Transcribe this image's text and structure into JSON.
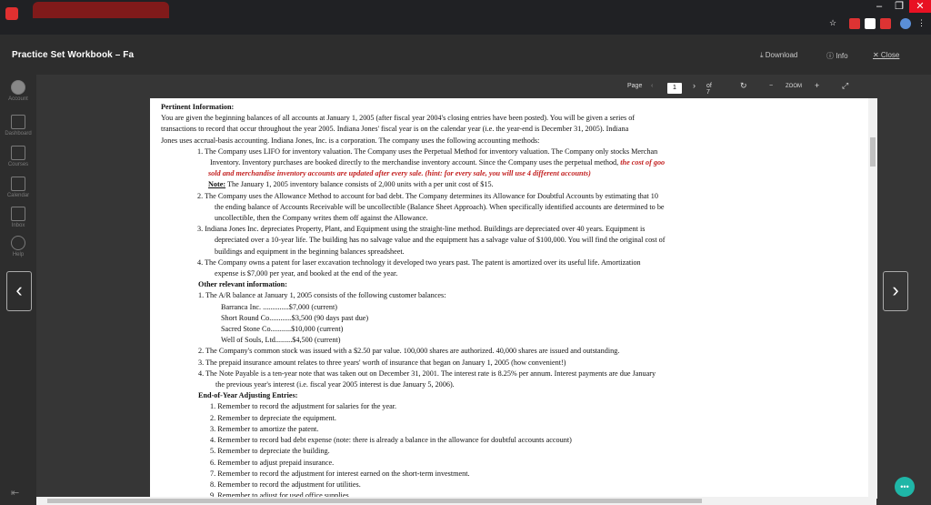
{
  "app": {
    "title": "Practice Set Workbook – Fa",
    "download": "⤓ Download",
    "info": "ⓘ Info",
    "close": "✕ Close"
  },
  "sidebar": {
    "items": [
      {
        "label": "Account",
        "icon": "account-icon"
      },
      {
        "label": "Dashboard",
        "icon": "dashboard-icon"
      },
      {
        "label": "Courses",
        "icon": "courses-icon"
      },
      {
        "label": "Calendar",
        "icon": "calendar-icon"
      },
      {
        "label": "Inbox",
        "icon": "inbox-icon"
      },
      {
        "label": "Help",
        "icon": "help-icon"
      }
    ]
  },
  "toolbar": {
    "page_label": "Page",
    "page_value": "1",
    "of_label": "of 7",
    "zoom_label": "ZOOM",
    "zoom_minus": "−",
    "zoom_plus": "+"
  },
  "doc": {
    "h1": "Pertinent Information:",
    "intro1": "You are given the beginning balances of all accounts at January 1, 2005 (after fiscal year 2004's closing entries have been posted).  You will be given a series of",
    "intro2": "transactions to record that occur throughout the year 2005.  Indiana Jones' fiscal year is on the calendar year (i.e. the year-end is December 31, 2005).  Indiana",
    "intro3": "Jones uses accrual-basis accounting.  Indiana Jones, Inc. is a corporation.  The company uses the following accounting methods:",
    "m1a": "1.  The Company uses LIFO for inventory valuation.  The Company uses the Perpetual Method for inventory valuation.  The Company only stocks Merchan",
    "m1b": "Inventory.  Inventory purchases are booked directly to the merchandise inventory account.  Since the Company uses the perpetual method, ",
    "m1b_red": "the cost of goo",
    "m1c_red": "sold and merchandise inventory accounts are updated after every sale.  (hint: for every sale, you will use 4 different accounts)",
    "m1d_note": "Note:",
    "m1d": "  The January 1, 2005 inventory balance consists of 2,000 units with a per unit cost of $15.",
    "m2a": "2.  The Company uses the Allowance Method to account for bad debt.  The Company determines its Allowance for Doubtful Accounts by estimating that 10",
    "m2b": "the ending balance of Accounts Receivable will be uncollectible (Balance Sheet Approach).  When specifically identified accounts are determined to be",
    "m2c": "uncollectible, then the Company writes them off against the Allowance.",
    "m3a": "3.  Indiana Jones Inc. depreciates Property, Plant, and Equipment using the straight-line method.  Buildings are depreciated over 40 years.  Equipment is",
    "m3b": "depreciated over a 10-year life.  The building has no salvage value and the equipment has a salvage value of $100,000.  You will find the original cost of",
    "m3c": "buildings and equipment in the beginning balances spreadsheet.",
    "m4a": "4.  The Company owns a patent for laser excavation technology it developed two years past.  The patent is amortized over its useful life.  Amortization",
    "m4b": "expense is $7,000 per year, and booked at the end of the year.",
    "h2": "Other relevant information:",
    "o1": "1.    The A/R balance at January 1, 2005 consists of the following customer balances:",
    "c1": "Barranca Inc. ..............$7,000  (current)",
    "c2": "Short Round Co............$3,500 (90 days past due)",
    "c3": "Sacred Stone Co...........$10,000  (current)",
    "c4": "Well of Souls, Ltd.........$4,500  (current)",
    "o2": "2.    The Company's common stock was issued with a $2.50 par value.  100,000 shares are authorized.  40,000 shares are issued and outstanding.",
    "o3": "3.    The prepaid insurance amount relates to three years' worth of insurance that began on January 1, 2005 (how convenient!)",
    "o4a": "4.    The Note Payable is a ten-year note that was taken out on December 31, 2001.  The interest rate is 8.25% per annum.  Interest payments are due January",
    "o4b": "the previous year's interest (i.e. fiscal year 2005 interest is due January 5, 2006).",
    "h3": "End-of-Year Adjusting Entries:",
    "e1": "1.   Remember to record the adjustment for salaries for the year.",
    "e2": "2.   Remember to depreciate the equipment.",
    "e3": "3.   Remember to amortize the patent.",
    "e4": "4.   Remember to record bad debt expense (note:  there is already a balance in the allowance for doubtful accounts account)",
    "e5": "5.   Remember to depreciate the building.",
    "e6": "6.   Remember to adjust prepaid insurance.",
    "e7": "7.   Remember to record the adjustment for interest earned on the short-term investment.",
    "e8": "8.   Remember to record the adjustment for utilities.",
    "e9": "9.   Remember to adjust for used office supplies."
  },
  "colors": {
    "accent_red": "#c21e1e",
    "chat": "#1fb6a7"
  }
}
